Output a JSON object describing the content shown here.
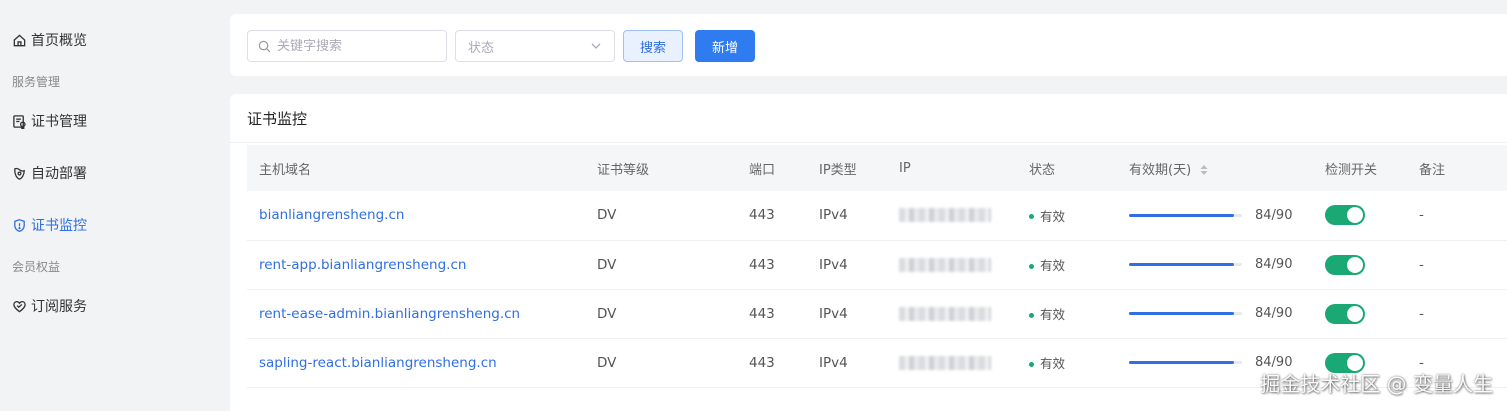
{
  "sidebar": {
    "items": [
      {
        "label": "首页概览",
        "icon": "home-icon"
      },
      {
        "label": "服务管理",
        "section": true
      },
      {
        "label": "证书管理",
        "icon": "certificate-icon"
      },
      {
        "label": "自动部署",
        "icon": "deploy-icon"
      },
      {
        "label": "证书监控",
        "icon": "shield-icon",
        "active": true
      },
      {
        "label": "会员权益",
        "section": true
      },
      {
        "label": "订阅服务",
        "icon": "heart-icon"
      }
    ]
  },
  "filter": {
    "search_placeholder": "关键字搜索",
    "status_placeholder": "状态",
    "search_button": "搜索",
    "add_button": "新增"
  },
  "panel": {
    "title": "证书监控"
  },
  "table": {
    "columns": [
      "主机域名",
      "证书等级",
      "端口",
      "IP类型",
      "IP",
      "状态",
      "有效期(天)",
      "检测开关",
      "备注"
    ],
    "rows": [
      {
        "host": "bianliangrensheng.cn",
        "level": "DV",
        "port": "443",
        "ip_type": "IPv4",
        "status": "有效",
        "validity": "84/90",
        "validity_fraction": 0.933,
        "switch_on": true,
        "remark": "-"
      },
      {
        "host": "rent-app.bianliangrensheng.cn",
        "level": "DV",
        "port": "443",
        "ip_type": "IPv4",
        "status": "有效",
        "validity": "84/90",
        "validity_fraction": 0.933,
        "switch_on": true,
        "remark": "-"
      },
      {
        "host": "rent-ease-admin.bianliangrensheng.cn",
        "level": "DV",
        "port": "443",
        "ip_type": "IPv4",
        "status": "有效",
        "validity": "84/90",
        "validity_fraction": 0.933,
        "switch_on": true,
        "remark": "-"
      },
      {
        "host": "sapling-react.bianliangrensheng.cn",
        "level": "DV",
        "port": "443",
        "ip_type": "IPv4",
        "status": "有效",
        "validity": "84/90",
        "validity_fraction": 0.933,
        "switch_on": true,
        "remark": "-"
      }
    ]
  },
  "colors": {
    "accent": "#2f6ee5",
    "success": "#1aa874",
    "background": "#f2f3f5"
  },
  "watermark": "掘金技术社区 @ 变量人生"
}
